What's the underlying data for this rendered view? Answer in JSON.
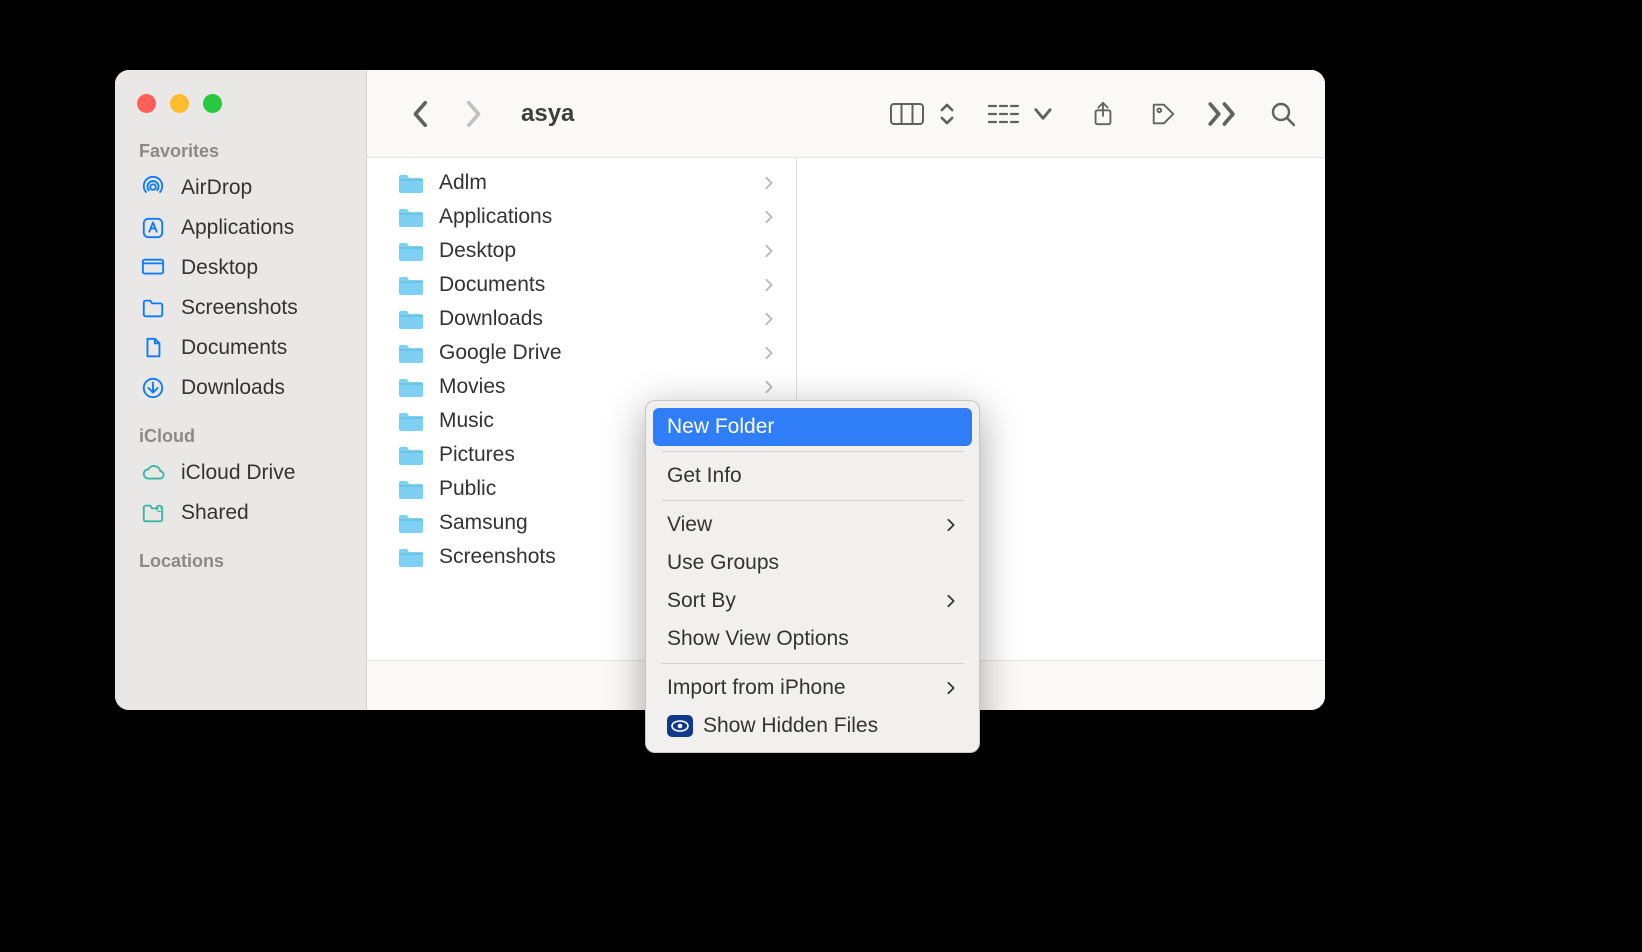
{
  "window": {
    "title": "asya"
  },
  "sidebar": {
    "sections": [
      {
        "label": "Favorites",
        "items": [
          {
            "icon": "airdrop",
            "label": "AirDrop"
          },
          {
            "icon": "app",
            "label": "Applications"
          },
          {
            "icon": "desktop",
            "label": "Desktop"
          },
          {
            "icon": "folder",
            "label": "Screenshots"
          },
          {
            "icon": "doc",
            "label": "Documents"
          },
          {
            "icon": "down",
            "label": "Downloads"
          }
        ]
      },
      {
        "label": "iCloud",
        "items": [
          {
            "icon": "cloud",
            "label": "iCloud Drive",
            "tint": "teal"
          },
          {
            "icon": "shared",
            "label": "Shared",
            "tint": "teal"
          }
        ]
      },
      {
        "label": "Locations",
        "items": []
      }
    ]
  },
  "column_items": [
    {
      "label": "Adlm"
    },
    {
      "label": "Applications"
    },
    {
      "label": "Desktop"
    },
    {
      "label": "Documents"
    },
    {
      "label": "Downloads"
    },
    {
      "label": "Google Drive"
    },
    {
      "label": "Movies"
    },
    {
      "label": "Music"
    },
    {
      "label": "Pictures"
    },
    {
      "label": "Public"
    },
    {
      "label": "Samsung"
    },
    {
      "label": "Screenshots"
    }
  ],
  "context_menu": {
    "groups": [
      [
        {
          "label": "New Folder",
          "highlight": true
        }
      ],
      [
        {
          "label": "Get Info"
        }
      ],
      [
        {
          "label": "View",
          "submenu": true
        },
        {
          "label": "Use Groups"
        },
        {
          "label": "Sort By",
          "submenu": true
        },
        {
          "label": "Show View Options"
        }
      ],
      [
        {
          "label": "Import from iPhone",
          "submenu": true
        },
        {
          "label": "Show Hidden Files",
          "icon": "eye"
        }
      ]
    ]
  }
}
